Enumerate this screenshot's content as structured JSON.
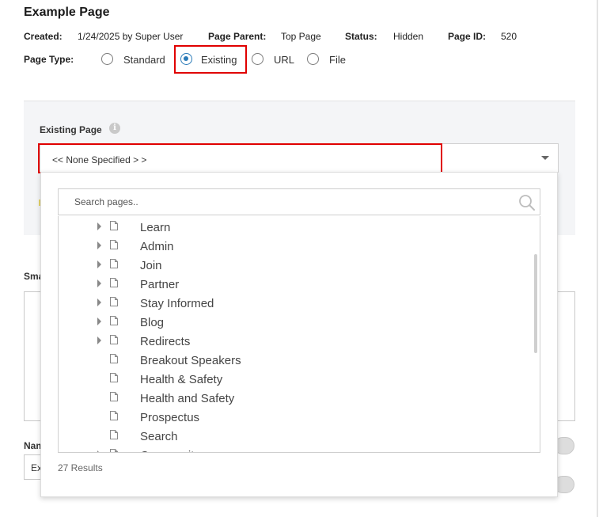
{
  "page": {
    "title": "Example Page"
  },
  "meta": {
    "created_label": "Created:",
    "created_value": "1/24/2025 by Super User",
    "parent_label": "Page Parent:",
    "parent_value": "Top Page",
    "status_label": "Status:",
    "status_value": "Hidden",
    "id_label": "Page ID:",
    "id_value": "520"
  },
  "page_type": {
    "label": "Page Type:",
    "options": [
      {
        "label": "Standard",
        "checked": false
      },
      {
        "label": "Existing",
        "checked": true
      },
      {
        "label": "URL",
        "checked": false
      },
      {
        "label": "File",
        "checked": false
      }
    ]
  },
  "existing_page": {
    "label": "Existing Page",
    "info_icon": "info-icon",
    "selected": "<< None Specified > >"
  },
  "background": {
    "sma_label": "Sma",
    "nam_label": "Nam",
    "ex_value": "Ex"
  },
  "dropdown": {
    "search_placeholder": "Search pages..",
    "items": [
      {
        "label": "Learn",
        "expandable": true
      },
      {
        "label": "Admin",
        "expandable": true
      },
      {
        "label": "Join",
        "expandable": true
      },
      {
        "label": "Partner",
        "expandable": true
      },
      {
        "label": "Stay Informed",
        "expandable": true
      },
      {
        "label": "Blog",
        "expandable": true
      },
      {
        "label": "Redirects",
        "expandable": true
      },
      {
        "label": "Breakout Speakers",
        "expandable": false
      },
      {
        "label": "Health & Safety",
        "expandable": false
      },
      {
        "label": "Health and Safety",
        "expandable": false
      },
      {
        "label": "Prospectus",
        "expandable": false
      },
      {
        "label": "Search",
        "expandable": false
      },
      {
        "label": "Community",
        "expandable": true
      }
    ],
    "results_text": "27 Results"
  },
  "colors": {
    "highlight": "#e00000",
    "radio_selected": "#2a7ab8",
    "panel_bg": "#f4f5f7"
  }
}
